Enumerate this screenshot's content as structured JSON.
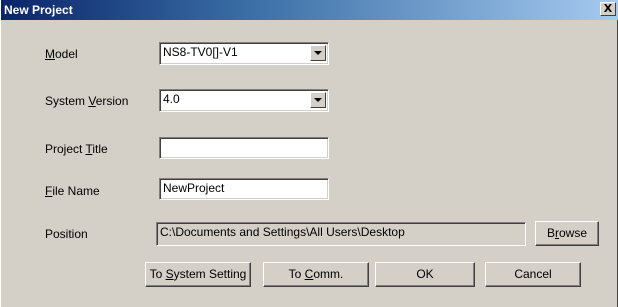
{
  "window": {
    "title": "New Project",
    "close_glyph": "X"
  },
  "model": {
    "label_mnemonic": "M",
    "label_rest": "odel",
    "value": "NS8-TV0[]-V1"
  },
  "system_version": {
    "label_pre": "System ",
    "label_mnemonic": "V",
    "label_rest": "ersion",
    "value": "4.0"
  },
  "project_title": {
    "label_pre": "Project ",
    "label_mnemonic": "T",
    "label_rest": "itle",
    "value": ""
  },
  "file_name": {
    "label_mnemonic": "F",
    "label_rest": "ile Name",
    "value": "NewProject"
  },
  "position": {
    "label": "Position",
    "value": "C:\\Documents and Settings\\All Users\\Desktop"
  },
  "browse_button": {
    "pre": "B",
    "mnemonic": "r",
    "rest": "owse"
  },
  "system_setting_button": {
    "pre": "To ",
    "mnemonic": "S",
    "rest": "ystem Setting"
  },
  "comm_button": {
    "pre": "To ",
    "mnemonic": "C",
    "rest": "omm."
  },
  "ok_button": {
    "label": "OK"
  },
  "cancel_button": {
    "label": "Cancel"
  }
}
